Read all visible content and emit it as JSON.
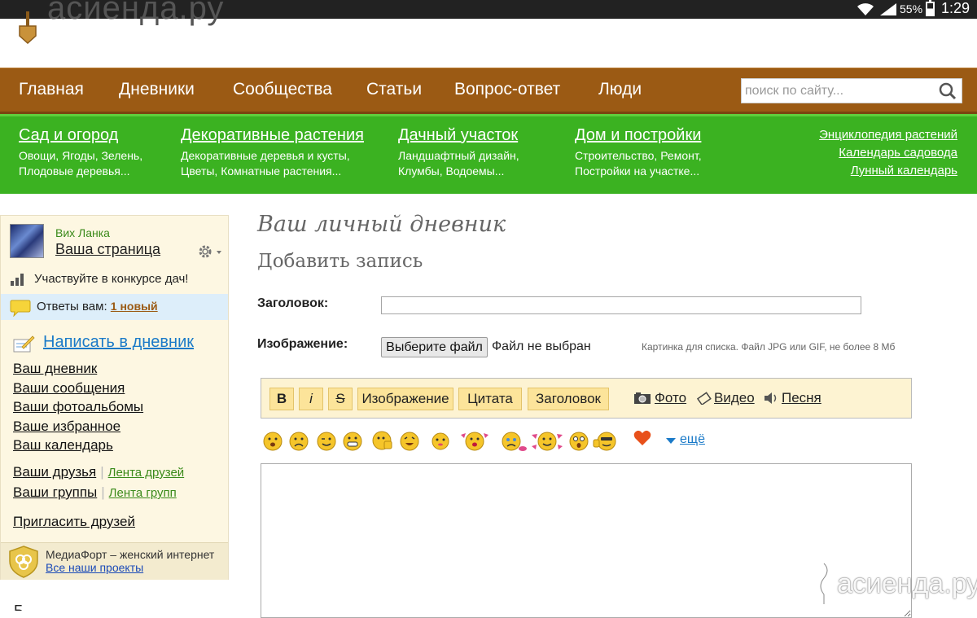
{
  "status_bar": {
    "battery": "55%",
    "time": "1:29"
  },
  "logo": {
    "text": "асиенда.ру"
  },
  "main_nav": {
    "items": [
      "Главная",
      "Дневники",
      "Сообщества",
      "Статьи",
      "Вопрос-ответ",
      "Люди"
    ],
    "search_placeholder": "поиск по сайту..."
  },
  "categories": [
    {
      "title": "Сад и огород",
      "line1": "Овощи, Ягоды, Зелень,",
      "line2": "Плодовые деревья..."
    },
    {
      "title": "Декоративные растения",
      "line1": "Декоративные деревья и кусты,",
      "line2": "Цветы, Комнатные растения..."
    },
    {
      "title": "Дачный участок",
      "line1": "Ландшафтный дизайн,",
      "line2": "Клумбы, Водоемы..."
    },
    {
      "title": "Дом и постройки",
      "line1": "Строительство, Ремонт,",
      "line2": "Постройки на участке..."
    }
  ],
  "category_links": [
    "Энциклопедия растений",
    "Календарь садовода",
    "Лунный календарь"
  ],
  "sidebar": {
    "username": "Вих Ланка",
    "my_page": "Ваша страница",
    "contest": "Участвуйте в конкурсе дач!",
    "answers_label": "Ответы вам:",
    "answers_new": "1 новый",
    "write": "Написать в дневник",
    "links": [
      "Ваш дневник",
      "Ваши сообщения",
      "Ваши фотоальбомы",
      "Ваше избранное",
      "Ваш календарь"
    ],
    "friends": "Ваши друзья",
    "friends_feed": "Лента друзей",
    "groups": "Ваши группы",
    "groups_feed": "Лента групп",
    "invite": "Пригласить друзей",
    "mediafort_text": "МедиаФорт – женский интернет",
    "mediafort_link": "Все наши проекты",
    "cut_text": "Б"
  },
  "main": {
    "title": "Ваш личный дневник",
    "subtitle": "Добавить запись",
    "heading_label": "Заголовок:",
    "image_label": "Изображение:",
    "file_button": "Выберите файл",
    "file_none": "Файл не выбран",
    "file_hint": "Картинка для списка. Файл JPG или GIF, не более 8 Мб"
  },
  "toolbar": {
    "bold": "B",
    "italic": "i",
    "strike": "S",
    "image": "Изображение",
    "quote": "Цитата",
    "heading": "Заголовок",
    "photo": "Фото",
    "video": "Видео",
    "song": "Песня"
  },
  "smileys": {
    "more": "ещё"
  },
  "watermark": {
    "text": "асиенда.ру"
  },
  "colors": {
    "nav_brown": "#9b5a14",
    "cat_green": "#3bb221",
    "sidebar_bg": "#fdf7e2",
    "link_blue": "#1a7ac8",
    "toolbar_btn": "#fce49a"
  }
}
